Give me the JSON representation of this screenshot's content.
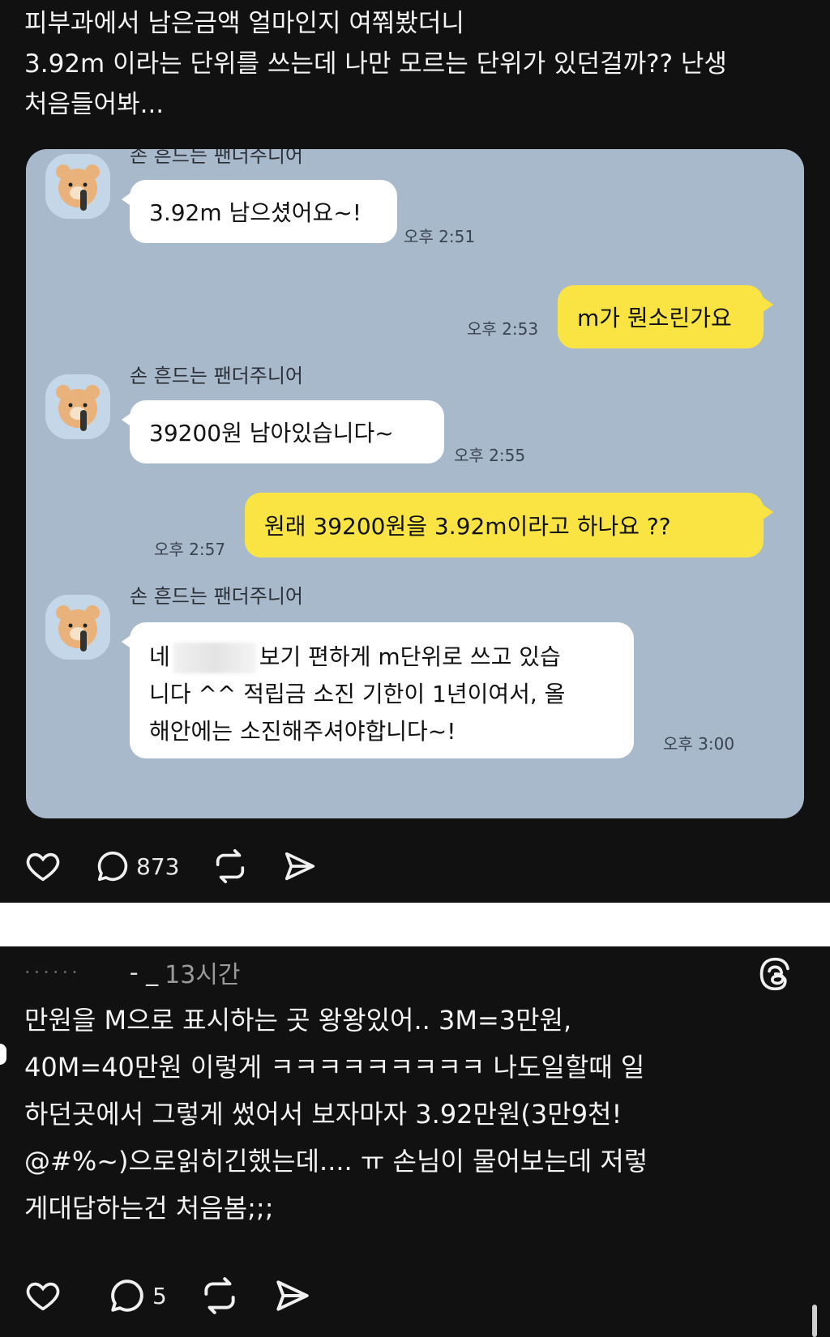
{
  "post1": {
    "text": "피부과에서 남은금액 얼마인지 여쭤봤더니\n3.92m 이라는 단위를 쓰는데 나만 모르는 단위가 있던걸까?? 난생\n처음들어봐...",
    "chat": {
      "sender_name": "손 흔드는 팬더주니어",
      "messages": [
        {
          "text": "3.92m 남으셨어요~!",
          "time": "오후 2:51"
        },
        {
          "text": "m가 뭔소린가요",
          "time": "오후 2:53"
        },
        {
          "text": "39200원 남아있습니다~",
          "time": "오후 2:55"
        },
        {
          "text": "원래 39200원을 3.92m이라고 하나요 ??",
          "time": "오후 2:57"
        },
        {
          "text_a": "네",
          "text_b": "보기 편하게 m단위로 쓰고 있습\n니다 ^^ 적립금 소진 기한이 1년이여서, 올\n해안에는 소진해주셔야합니다~!",
          "time": "오후 3:00"
        }
      ]
    },
    "actions": {
      "like_icon": "heart-icon",
      "comment_icon": "comment-icon",
      "comment_count": "873",
      "repost_icon": "repost-icon",
      "share_icon": "send-icon"
    }
  },
  "post2": {
    "author_fragment": "- _",
    "time": "13시간",
    "threads_icon": "threads-logo-icon",
    "text": "만원을 M으로 표시하는 곳 왕왕있어.. 3M=3만원,\n40M=40만원 이렇게 ㅋㅋㅋㅋㅋㅋㅋㅋㅋ 나도일할때 일\n하던곳에서 그렇게 썼어서 보자마자 3.92만원(3만9천!\n@#%~)으로읽히긴했는데.... ㅠ 손님이 물어보는데 저렇\n게대답하는건 처음봄;;;",
    "actions": {
      "comment_count": "5"
    }
  },
  "colors": {
    "chat_bg": "#a9b9cc",
    "my_bubble": "#f9e443",
    "their_bubble": "#ffffff",
    "post_bg": "#111111"
  }
}
